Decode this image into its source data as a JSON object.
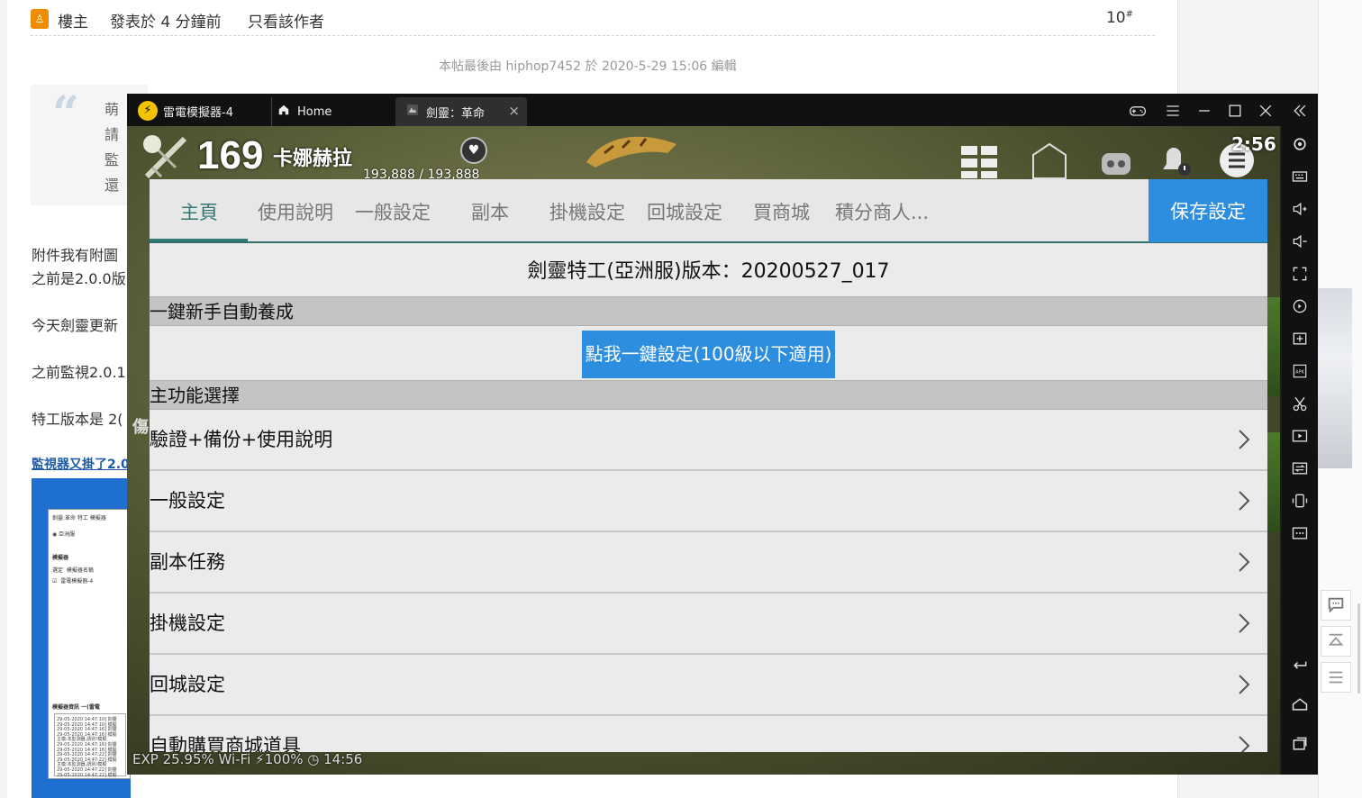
{
  "forum": {
    "post_author": "樓主",
    "post_time": "發表於 4 分鐘前",
    "view_author_only": "只看該作者",
    "floor_number": "10",
    "floor_suffix": "#",
    "edit_note": "本帖最後由 hiphop7452 於 2020-5-29 15:06 編輯",
    "quote_lines": [
      "萌",
      "請",
      "監",
      "還"
    ],
    "body_lines": [
      "附件我有附圖",
      "之前是2.0.0版",
      "今天劍靈更新",
      "之前監視2.0.1",
      "特工版本是 2("
    ],
    "link_text": "監視器又掛了2.0",
    "attachment": {
      "window_title": "劍靈:革命 特工 模擬器",
      "radio_label": "亞洲服",
      "section_label": "模擬器",
      "col_select": "選定",
      "col_name": "模擬器名稱",
      "row_name": "雷電模擬器-4",
      "log_header": "模擬器資訊 一(雷電",
      "log_lines": [
        "29-05-2020 14:47:10] 劍靈",
        "29-05-2020 14:47:10] 模擬",
        "29-05-2020 14:47:16] 劍靈",
        "29-05-2020 14:47:16] 模擬",
        "主模:本監測器,請別!模擬",
        "29-05-2020 14:47:16] 劍靈",
        "29-05-2020 14:47:16] 模擬",
        "29-05-2020 14:47:22] 劍靈",
        "29-05-2020 14:47:22] 模擬",
        "主模:本監測器,請別!模擬",
        "29-05-2020 14:47:22] 劍靈",
        "29-05-2020 14:47:22] 模擬"
      ]
    }
  },
  "emulator": {
    "logo_glyph": "⚡",
    "title": "雷電模擬器-4",
    "tabs": [
      {
        "label": "Home",
        "icon": "home-icon"
      },
      {
        "label": "劍靈：革命",
        "icon": "game-icon",
        "close": "×"
      }
    ]
  },
  "game": {
    "level": "169",
    "character_name": "卡娜赫拉",
    "hp": "193,888 / 193,888",
    "time": "2:56",
    "shop_label": "商店",
    "left_deco": "傷",
    "bottom_status": "EXP 25.95%   Wi-Fi ⚡100% ◷ 14:56"
  },
  "panel": {
    "tabs": [
      "主頁",
      "使用說明",
      "一般設定",
      "副本",
      "掛機設定",
      "回城設定",
      "買商城",
      "積分商人..."
    ],
    "active_tab": 0,
    "save_button": "保存設定",
    "version_text": "劍靈特工(亞洲服)版本：20200527_017",
    "section_newbie": "一鍵新手自動養成",
    "one_key_button": "點我一鍵設定(100級以下適用)",
    "section_main": "主功能選擇",
    "menu_items": [
      "驗證+備份+使用說明",
      "一般設定",
      "副本任務",
      "掛機設定",
      "回城設定",
      "自動購買商城道具"
    ]
  },
  "colors": {
    "accent_teal": "#2f7a75",
    "button_blue": "#2d8ee0",
    "section_gray": "#c4c4c4",
    "emulator_dark": "#111111"
  }
}
